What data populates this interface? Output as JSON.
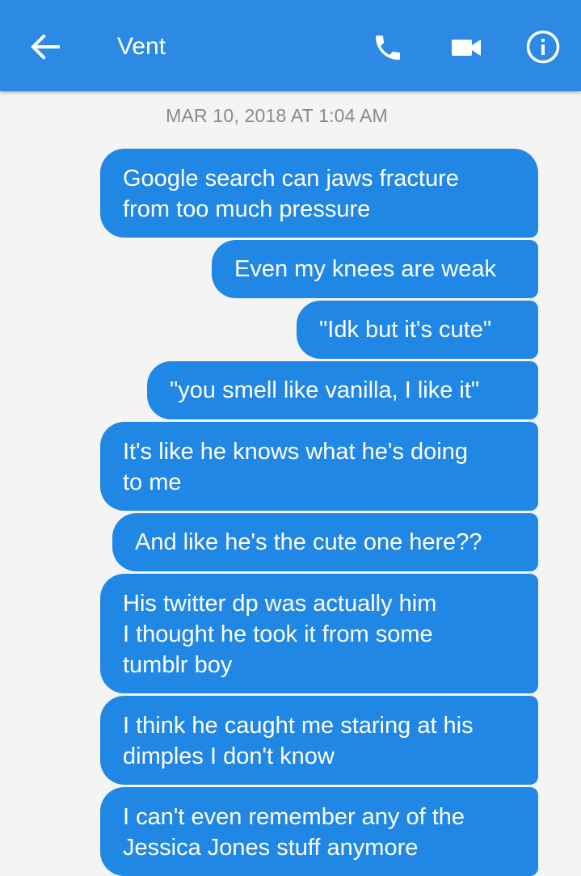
{
  "header": {
    "title": "Vent",
    "icons": {
      "back": "arrow-left-icon",
      "call": "phone-icon",
      "video": "video-camera-icon",
      "info": "info-icon"
    },
    "colors": {
      "bar": "#2d8ae4",
      "bubble": "#2187e5",
      "background": "#f4f4f4"
    }
  },
  "conversation": {
    "timestamp": "MAR 10, 2018 AT 1:04 AM",
    "messages": [
      "Google search can jaws fracture\nfrom too much pressure",
      "Even my knees are weak",
      "\"Idk but it's cute\"",
      "\"you smell like vanilla, I like it\"",
      "It's like he knows what he's doing\nto me",
      "And like he's the cute one here??",
      "His twitter dp was actually him\nI thought he took it from some\ntumblr boy",
      "I think he caught me staring at his\ndimples I don't know",
      "I can't even remember any of the\nJessica Jones stuff anymore"
    ]
  }
}
